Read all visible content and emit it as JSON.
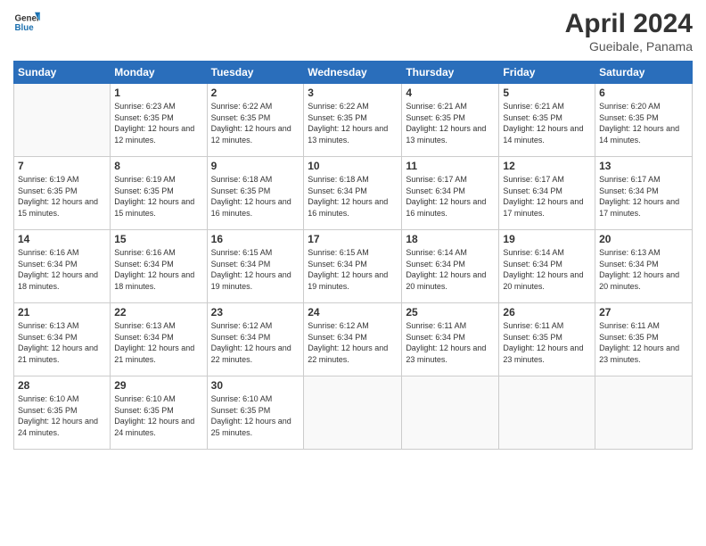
{
  "logo": {
    "text_general": "General",
    "text_blue": "Blue"
  },
  "title": "April 2024",
  "subtitle": "Gueibale, Panama",
  "headers": [
    "Sunday",
    "Monday",
    "Tuesday",
    "Wednesday",
    "Thursday",
    "Friday",
    "Saturday"
  ],
  "weeks": [
    [
      {
        "day": "",
        "sunrise": "",
        "sunset": "",
        "daylight": ""
      },
      {
        "day": "1",
        "sunrise": "Sunrise: 6:23 AM",
        "sunset": "Sunset: 6:35 PM",
        "daylight": "Daylight: 12 hours and 12 minutes."
      },
      {
        "day": "2",
        "sunrise": "Sunrise: 6:22 AM",
        "sunset": "Sunset: 6:35 PM",
        "daylight": "Daylight: 12 hours and 12 minutes."
      },
      {
        "day": "3",
        "sunrise": "Sunrise: 6:22 AM",
        "sunset": "Sunset: 6:35 PM",
        "daylight": "Daylight: 12 hours and 13 minutes."
      },
      {
        "day": "4",
        "sunrise": "Sunrise: 6:21 AM",
        "sunset": "Sunset: 6:35 PM",
        "daylight": "Daylight: 12 hours and 13 minutes."
      },
      {
        "day": "5",
        "sunrise": "Sunrise: 6:21 AM",
        "sunset": "Sunset: 6:35 PM",
        "daylight": "Daylight: 12 hours and 14 minutes."
      },
      {
        "day": "6",
        "sunrise": "Sunrise: 6:20 AM",
        "sunset": "Sunset: 6:35 PM",
        "daylight": "Daylight: 12 hours and 14 minutes."
      }
    ],
    [
      {
        "day": "7",
        "sunrise": "Sunrise: 6:19 AM",
        "sunset": "Sunset: 6:35 PM",
        "daylight": "Daylight: 12 hours and 15 minutes."
      },
      {
        "day": "8",
        "sunrise": "Sunrise: 6:19 AM",
        "sunset": "Sunset: 6:35 PM",
        "daylight": "Daylight: 12 hours and 15 minutes."
      },
      {
        "day": "9",
        "sunrise": "Sunrise: 6:18 AM",
        "sunset": "Sunset: 6:35 PM",
        "daylight": "Daylight: 12 hours and 16 minutes."
      },
      {
        "day": "10",
        "sunrise": "Sunrise: 6:18 AM",
        "sunset": "Sunset: 6:34 PM",
        "daylight": "Daylight: 12 hours and 16 minutes."
      },
      {
        "day": "11",
        "sunrise": "Sunrise: 6:17 AM",
        "sunset": "Sunset: 6:34 PM",
        "daylight": "Daylight: 12 hours and 16 minutes."
      },
      {
        "day": "12",
        "sunrise": "Sunrise: 6:17 AM",
        "sunset": "Sunset: 6:34 PM",
        "daylight": "Daylight: 12 hours and 17 minutes."
      },
      {
        "day": "13",
        "sunrise": "Sunrise: 6:17 AM",
        "sunset": "Sunset: 6:34 PM",
        "daylight": "Daylight: 12 hours and 17 minutes."
      }
    ],
    [
      {
        "day": "14",
        "sunrise": "Sunrise: 6:16 AM",
        "sunset": "Sunset: 6:34 PM",
        "daylight": "Daylight: 12 hours and 18 minutes."
      },
      {
        "day": "15",
        "sunrise": "Sunrise: 6:16 AM",
        "sunset": "Sunset: 6:34 PM",
        "daylight": "Daylight: 12 hours and 18 minutes."
      },
      {
        "day": "16",
        "sunrise": "Sunrise: 6:15 AM",
        "sunset": "Sunset: 6:34 PM",
        "daylight": "Daylight: 12 hours and 19 minutes."
      },
      {
        "day": "17",
        "sunrise": "Sunrise: 6:15 AM",
        "sunset": "Sunset: 6:34 PM",
        "daylight": "Daylight: 12 hours and 19 minutes."
      },
      {
        "day": "18",
        "sunrise": "Sunrise: 6:14 AM",
        "sunset": "Sunset: 6:34 PM",
        "daylight": "Daylight: 12 hours and 20 minutes."
      },
      {
        "day": "19",
        "sunrise": "Sunrise: 6:14 AM",
        "sunset": "Sunset: 6:34 PM",
        "daylight": "Daylight: 12 hours and 20 minutes."
      },
      {
        "day": "20",
        "sunrise": "Sunrise: 6:13 AM",
        "sunset": "Sunset: 6:34 PM",
        "daylight": "Daylight: 12 hours and 20 minutes."
      }
    ],
    [
      {
        "day": "21",
        "sunrise": "Sunrise: 6:13 AM",
        "sunset": "Sunset: 6:34 PM",
        "daylight": "Daylight: 12 hours and 21 minutes."
      },
      {
        "day": "22",
        "sunrise": "Sunrise: 6:13 AM",
        "sunset": "Sunset: 6:34 PM",
        "daylight": "Daylight: 12 hours and 21 minutes."
      },
      {
        "day": "23",
        "sunrise": "Sunrise: 6:12 AM",
        "sunset": "Sunset: 6:34 PM",
        "daylight": "Daylight: 12 hours and 22 minutes."
      },
      {
        "day": "24",
        "sunrise": "Sunrise: 6:12 AM",
        "sunset": "Sunset: 6:34 PM",
        "daylight": "Daylight: 12 hours and 22 minutes."
      },
      {
        "day": "25",
        "sunrise": "Sunrise: 6:11 AM",
        "sunset": "Sunset: 6:34 PM",
        "daylight": "Daylight: 12 hours and 23 minutes."
      },
      {
        "day": "26",
        "sunrise": "Sunrise: 6:11 AM",
        "sunset": "Sunset: 6:35 PM",
        "daylight": "Daylight: 12 hours and 23 minutes."
      },
      {
        "day": "27",
        "sunrise": "Sunrise: 6:11 AM",
        "sunset": "Sunset: 6:35 PM",
        "daylight": "Daylight: 12 hours and 23 minutes."
      }
    ],
    [
      {
        "day": "28",
        "sunrise": "Sunrise: 6:10 AM",
        "sunset": "Sunset: 6:35 PM",
        "daylight": "Daylight: 12 hours and 24 minutes."
      },
      {
        "day": "29",
        "sunrise": "Sunrise: 6:10 AM",
        "sunset": "Sunset: 6:35 PM",
        "daylight": "Daylight: 12 hours and 24 minutes."
      },
      {
        "day": "30",
        "sunrise": "Sunrise: 6:10 AM",
        "sunset": "Sunset: 6:35 PM",
        "daylight": "Daylight: 12 hours and 25 minutes."
      },
      {
        "day": "",
        "sunrise": "",
        "sunset": "",
        "daylight": ""
      },
      {
        "day": "",
        "sunrise": "",
        "sunset": "",
        "daylight": ""
      },
      {
        "day": "",
        "sunrise": "",
        "sunset": "",
        "daylight": ""
      },
      {
        "day": "",
        "sunrise": "",
        "sunset": "",
        "daylight": ""
      }
    ]
  ]
}
